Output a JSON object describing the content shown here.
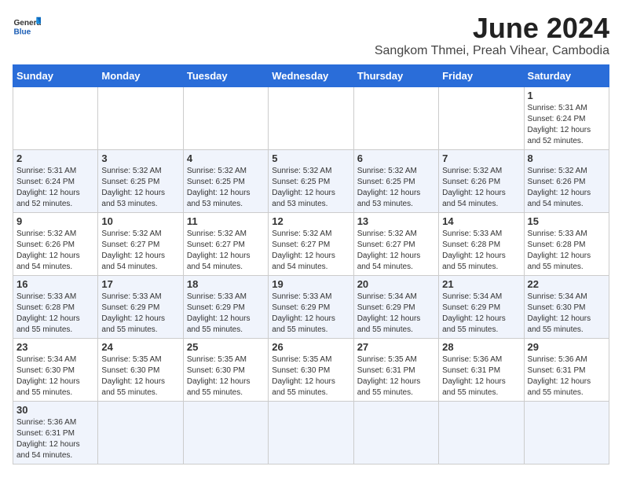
{
  "logo": {
    "text_general": "General",
    "text_blue": "Blue"
  },
  "header": {
    "title": "June 2024",
    "subtitle": "Sangkom Thmei, Preah Vihear, Cambodia"
  },
  "weekdays": [
    "Sunday",
    "Monday",
    "Tuesday",
    "Wednesday",
    "Thursday",
    "Friday",
    "Saturday"
  ],
  "weeks": [
    {
      "days": [
        {
          "num": "",
          "info": ""
        },
        {
          "num": "",
          "info": ""
        },
        {
          "num": "",
          "info": ""
        },
        {
          "num": "",
          "info": ""
        },
        {
          "num": "",
          "info": ""
        },
        {
          "num": "",
          "info": ""
        },
        {
          "num": "1",
          "info": "Sunrise: 5:31 AM\nSunset: 6:24 PM\nDaylight: 12 hours\nand 52 minutes."
        }
      ]
    },
    {
      "days": [
        {
          "num": "2",
          "info": "Sunrise: 5:31 AM\nSunset: 6:24 PM\nDaylight: 12 hours\nand 52 minutes."
        },
        {
          "num": "3",
          "info": "Sunrise: 5:32 AM\nSunset: 6:25 PM\nDaylight: 12 hours\nand 53 minutes."
        },
        {
          "num": "4",
          "info": "Sunrise: 5:32 AM\nSunset: 6:25 PM\nDaylight: 12 hours\nand 53 minutes."
        },
        {
          "num": "5",
          "info": "Sunrise: 5:32 AM\nSunset: 6:25 PM\nDaylight: 12 hours\nand 53 minutes."
        },
        {
          "num": "6",
          "info": "Sunrise: 5:32 AM\nSunset: 6:25 PM\nDaylight: 12 hours\nand 53 minutes."
        },
        {
          "num": "7",
          "info": "Sunrise: 5:32 AM\nSunset: 6:26 PM\nDaylight: 12 hours\nand 54 minutes."
        },
        {
          "num": "8",
          "info": "Sunrise: 5:32 AM\nSunset: 6:26 PM\nDaylight: 12 hours\nand 54 minutes."
        }
      ]
    },
    {
      "days": [
        {
          "num": "9",
          "info": "Sunrise: 5:32 AM\nSunset: 6:26 PM\nDaylight: 12 hours\nand 54 minutes."
        },
        {
          "num": "10",
          "info": "Sunrise: 5:32 AM\nSunset: 6:27 PM\nDaylight: 12 hours\nand 54 minutes."
        },
        {
          "num": "11",
          "info": "Sunrise: 5:32 AM\nSunset: 6:27 PM\nDaylight: 12 hours\nand 54 minutes."
        },
        {
          "num": "12",
          "info": "Sunrise: 5:32 AM\nSunset: 6:27 PM\nDaylight: 12 hours\nand 54 minutes."
        },
        {
          "num": "13",
          "info": "Sunrise: 5:32 AM\nSunset: 6:27 PM\nDaylight: 12 hours\nand 54 minutes."
        },
        {
          "num": "14",
          "info": "Sunrise: 5:33 AM\nSunset: 6:28 PM\nDaylight: 12 hours\nand 55 minutes."
        },
        {
          "num": "15",
          "info": "Sunrise: 5:33 AM\nSunset: 6:28 PM\nDaylight: 12 hours\nand 55 minutes."
        }
      ]
    },
    {
      "days": [
        {
          "num": "16",
          "info": "Sunrise: 5:33 AM\nSunset: 6:28 PM\nDaylight: 12 hours\nand 55 minutes."
        },
        {
          "num": "17",
          "info": "Sunrise: 5:33 AM\nSunset: 6:29 PM\nDaylight: 12 hours\nand 55 minutes."
        },
        {
          "num": "18",
          "info": "Sunrise: 5:33 AM\nSunset: 6:29 PM\nDaylight: 12 hours\nand 55 minutes."
        },
        {
          "num": "19",
          "info": "Sunrise: 5:33 AM\nSunset: 6:29 PM\nDaylight: 12 hours\nand 55 minutes."
        },
        {
          "num": "20",
          "info": "Sunrise: 5:34 AM\nSunset: 6:29 PM\nDaylight: 12 hours\nand 55 minutes."
        },
        {
          "num": "21",
          "info": "Sunrise: 5:34 AM\nSunset: 6:29 PM\nDaylight: 12 hours\nand 55 minutes."
        },
        {
          "num": "22",
          "info": "Sunrise: 5:34 AM\nSunset: 6:30 PM\nDaylight: 12 hours\nand 55 minutes."
        }
      ]
    },
    {
      "days": [
        {
          "num": "23",
          "info": "Sunrise: 5:34 AM\nSunset: 6:30 PM\nDaylight: 12 hours\nand 55 minutes."
        },
        {
          "num": "24",
          "info": "Sunrise: 5:35 AM\nSunset: 6:30 PM\nDaylight: 12 hours\nand 55 minutes."
        },
        {
          "num": "25",
          "info": "Sunrise: 5:35 AM\nSunset: 6:30 PM\nDaylight: 12 hours\nand 55 minutes."
        },
        {
          "num": "26",
          "info": "Sunrise: 5:35 AM\nSunset: 6:30 PM\nDaylight: 12 hours\nand 55 minutes."
        },
        {
          "num": "27",
          "info": "Sunrise: 5:35 AM\nSunset: 6:31 PM\nDaylight: 12 hours\nand 55 minutes."
        },
        {
          "num": "28",
          "info": "Sunrise: 5:36 AM\nSunset: 6:31 PM\nDaylight: 12 hours\nand 55 minutes."
        },
        {
          "num": "29",
          "info": "Sunrise: 5:36 AM\nSunset: 6:31 PM\nDaylight: 12 hours\nand 55 minutes."
        }
      ]
    },
    {
      "days": [
        {
          "num": "30",
          "info": "Sunrise: 5:36 AM\nSunset: 6:31 PM\nDaylight: 12 hours\nand 54 minutes."
        },
        {
          "num": "",
          "info": ""
        },
        {
          "num": "",
          "info": ""
        },
        {
          "num": "",
          "info": ""
        },
        {
          "num": "",
          "info": ""
        },
        {
          "num": "",
          "info": ""
        },
        {
          "num": "",
          "info": ""
        }
      ]
    }
  ]
}
